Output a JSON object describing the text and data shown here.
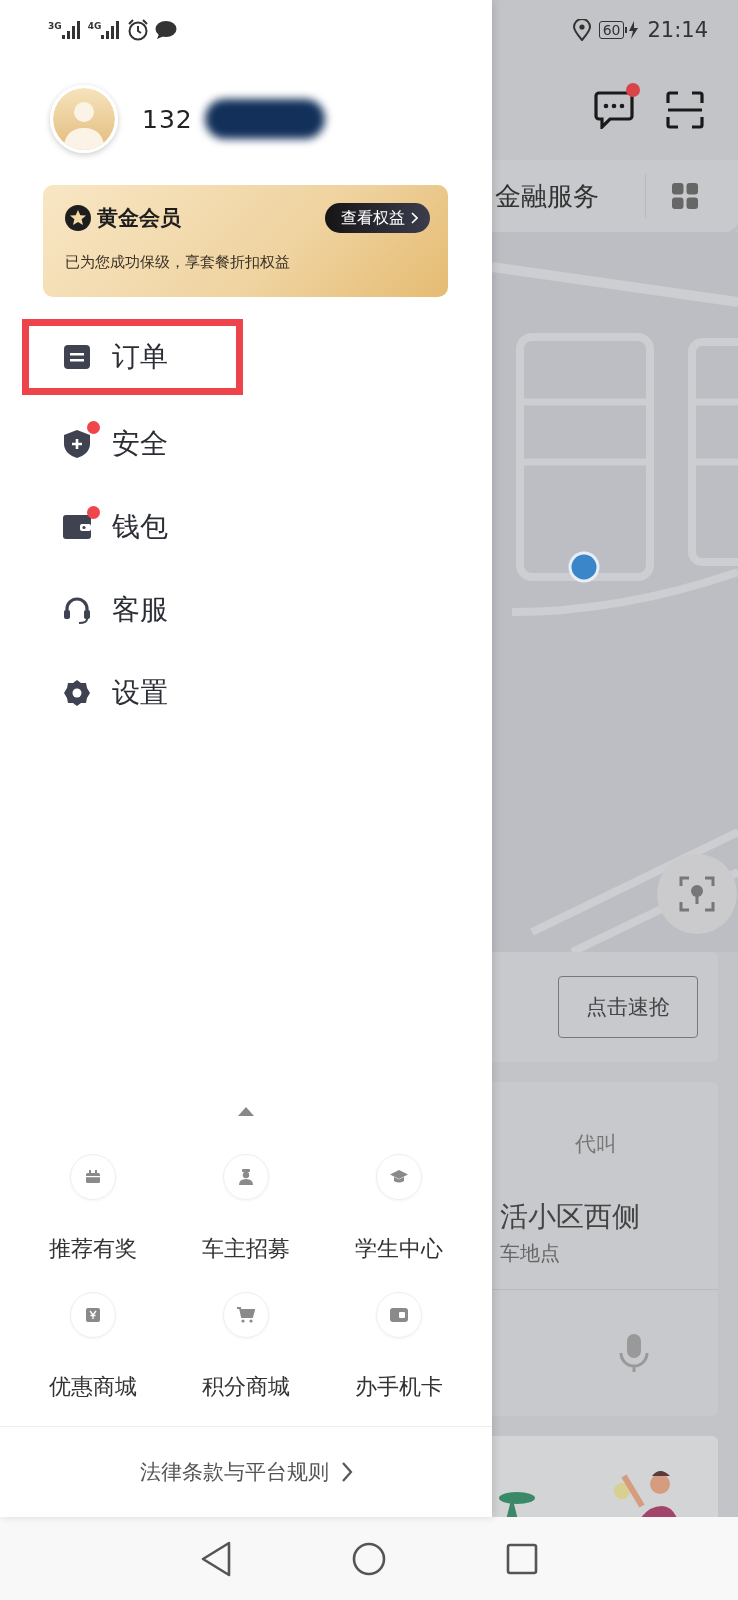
{
  "status_bar": {
    "networks": [
      "3G",
      "4G"
    ],
    "battery": "60",
    "time": "21:14"
  },
  "profile": {
    "phone": "132",
    "redacted": true
  },
  "member_card": {
    "title": "黄金会员",
    "button": "查看权益",
    "subtitle": "已为您成功保级，享套餐折扣权益"
  },
  "menu": [
    {
      "label": "订单",
      "kind": "order",
      "badge": false,
      "highlighted": true
    },
    {
      "label": "安全",
      "kind": "shield",
      "badge": true,
      "highlighted": false
    },
    {
      "label": "钱包",
      "kind": "wallet",
      "badge": true,
      "highlighted": false
    },
    {
      "label": "客服",
      "kind": "headset",
      "badge": false,
      "highlighted": false
    },
    {
      "label": "设置",
      "kind": "gear",
      "badge": false,
      "highlighted": false
    }
  ],
  "shortcuts": [
    {
      "label": "推荐有奖",
      "kind": "gift"
    },
    {
      "label": "车主招募",
      "kind": "driver"
    },
    {
      "label": "学生中心",
      "kind": "student"
    },
    {
      "label": "优惠商城",
      "kind": "coupon"
    },
    {
      "label": "积分商城",
      "kind": "cart"
    },
    {
      "label": "办手机卡",
      "kind": "simcard"
    }
  ],
  "legal_link": "法律条款与平台规则",
  "background": {
    "messages_badge": true,
    "tab_label": "金融服务",
    "grab_button": "点击速抢",
    "request_card": {
      "title": "代叫",
      "place": "活小区西侧",
      "hint": "车地点"
    }
  }
}
